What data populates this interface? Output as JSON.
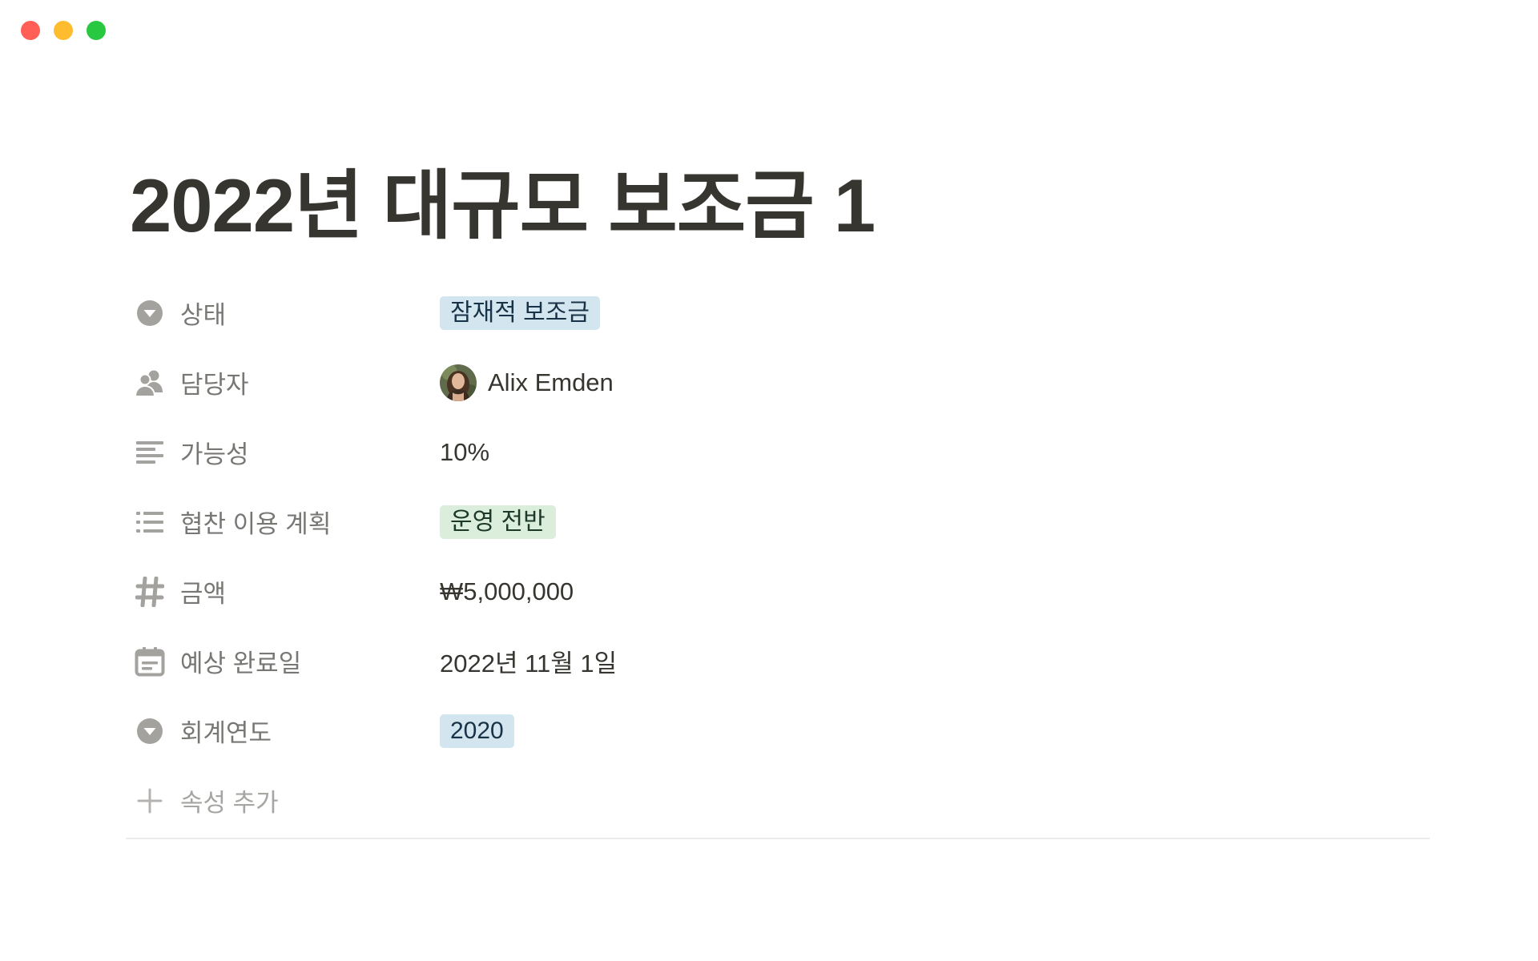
{
  "window": {
    "controls": {
      "close_color": "#ff5f57",
      "minimize_color": "#febc2e",
      "zoom_color": "#28c840"
    }
  },
  "page": {
    "title": "2022년 대규모 보조금 1"
  },
  "properties": [
    {
      "icon": "select-icon",
      "label": "상태",
      "value": "잠재적 보조금",
      "type": "tag",
      "tag_bg": "#d3e5ef",
      "tag_color": "#183347"
    },
    {
      "icon": "person-icon",
      "label": "담당자",
      "value": "Alix Emden",
      "type": "person"
    },
    {
      "icon": "text-icon",
      "label": "가능성",
      "value": "10%",
      "type": "text"
    },
    {
      "icon": "list-icon",
      "label": "협찬 이용 계획",
      "value": "운영 전반",
      "type": "tag",
      "tag_bg": "#dbeddb",
      "tag_color": "#1c3829"
    },
    {
      "icon": "number-icon",
      "label": "금액",
      "value": "₩5,000,000",
      "type": "text"
    },
    {
      "icon": "calendar-icon",
      "label": "예상 완료일",
      "value": "2022년 11월 1일",
      "type": "text"
    },
    {
      "icon": "select-icon",
      "label": "회계연도",
      "value": "2020",
      "type": "tag",
      "tag_bg": "#d3e5ef",
      "tag_color": "#183347"
    }
  ],
  "add_property": {
    "icon": "plus-icon",
    "label": "속성 추가"
  }
}
